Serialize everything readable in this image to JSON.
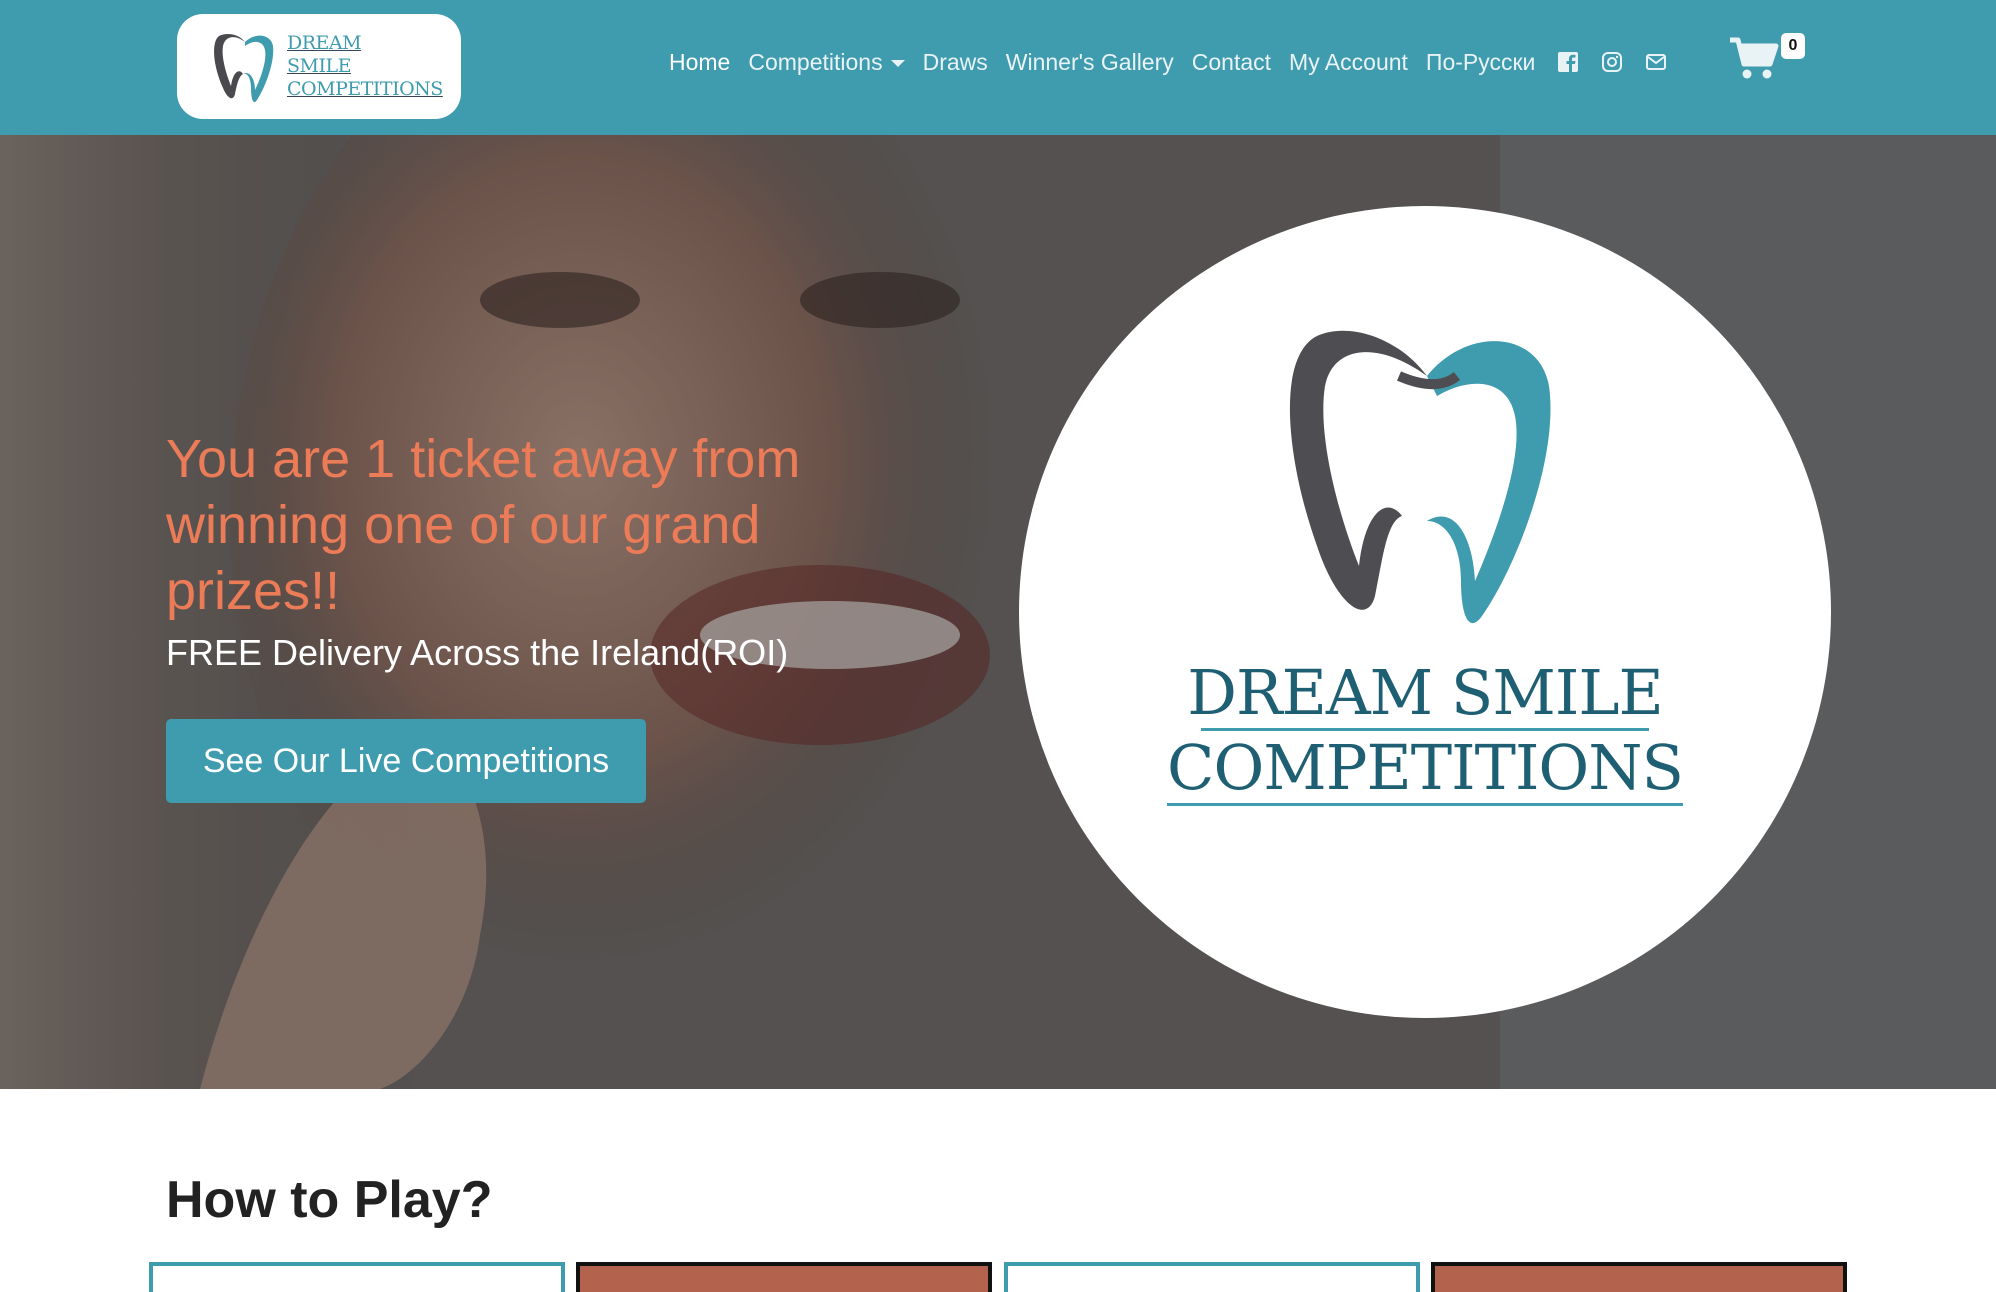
{
  "brand": {
    "line1": "DREAM",
    "line2": "SMILE",
    "line3": "COMPETITIONS"
  },
  "nav": {
    "items": [
      {
        "label": "Home"
      },
      {
        "label": "Competitions"
      },
      {
        "label": "Draws"
      },
      {
        "label": "Winner's Gallery"
      },
      {
        "label": "Contact"
      },
      {
        "label": "My Account"
      },
      {
        "label": "По-Русски"
      }
    ],
    "social_icons": [
      "facebook-icon",
      "instagram-icon",
      "envelope-icon"
    ],
    "cart_count": "0"
  },
  "hero": {
    "heading": "You are 1 ticket away from winning one of our grand prizes!!",
    "subheading": "FREE Delivery Across the Ireland(ROI)",
    "button_label": "See Our Live Competitions",
    "logo_line1": "DREAM SMILE",
    "logo_line2": "COMPETITIONS"
  },
  "howto": {
    "title": "How to Play?"
  },
  "colors": {
    "teal": "#3f9bae",
    "accent": "#ec7b57",
    "card_fill": "#b3634d"
  }
}
